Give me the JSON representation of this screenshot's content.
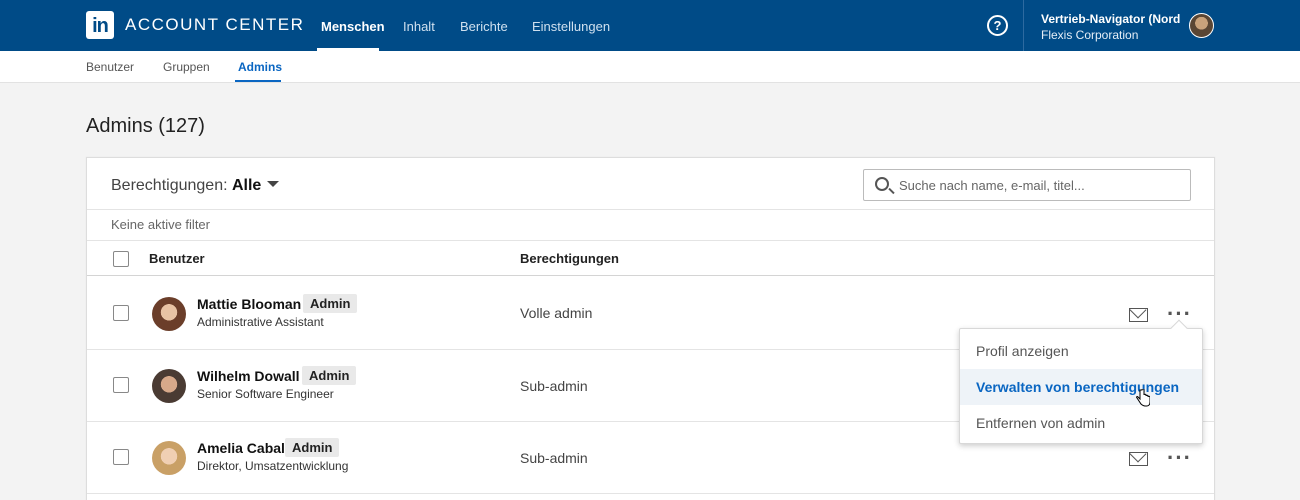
{
  "topbar": {
    "logo_text": "in",
    "app_title": "ACCOUNT CENTER",
    "nav": [
      "Menschen",
      "Inhalt",
      "Berichte",
      "Einstellungen"
    ],
    "help_glyph": "?",
    "account_name": "Vertrieb-Navigator (Nordic",
    "account_org": "Flexis Corporation"
  },
  "subnav": [
    "Benutzer",
    "Gruppen",
    "Admins"
  ],
  "page": {
    "title": "Admins (127)"
  },
  "filter": {
    "label": "Berechtigungen:",
    "value": "Alle",
    "no_filters": "Keine aktive filter"
  },
  "search": {
    "placeholder": "Suche nach name, e-mail, titel..."
  },
  "table": {
    "headers": [
      "Benutzer",
      "Berechtigungen"
    ],
    "rows": [
      {
        "name": "Mattie Blooman",
        "badge": "Admin",
        "title": "Administrative Assistant",
        "permission": "Volle admin"
      },
      {
        "name": "Wilhelm Dowall",
        "badge": "Admin",
        "title": "Senior Software Engineer",
        "permission": "Sub-admin"
      },
      {
        "name": "Amelia Cabal",
        "badge": "Admin",
        "title": "Direktor, Umsatzentwicklung",
        "permission": "Sub-admin"
      }
    ]
  },
  "menu": {
    "items": [
      "Profil anzeigen",
      "Verwalten von berechtigungen",
      "Entfernen von admin"
    ]
  },
  "colors": {
    "brand": "#004b87",
    "accent": "#0a66c2"
  }
}
